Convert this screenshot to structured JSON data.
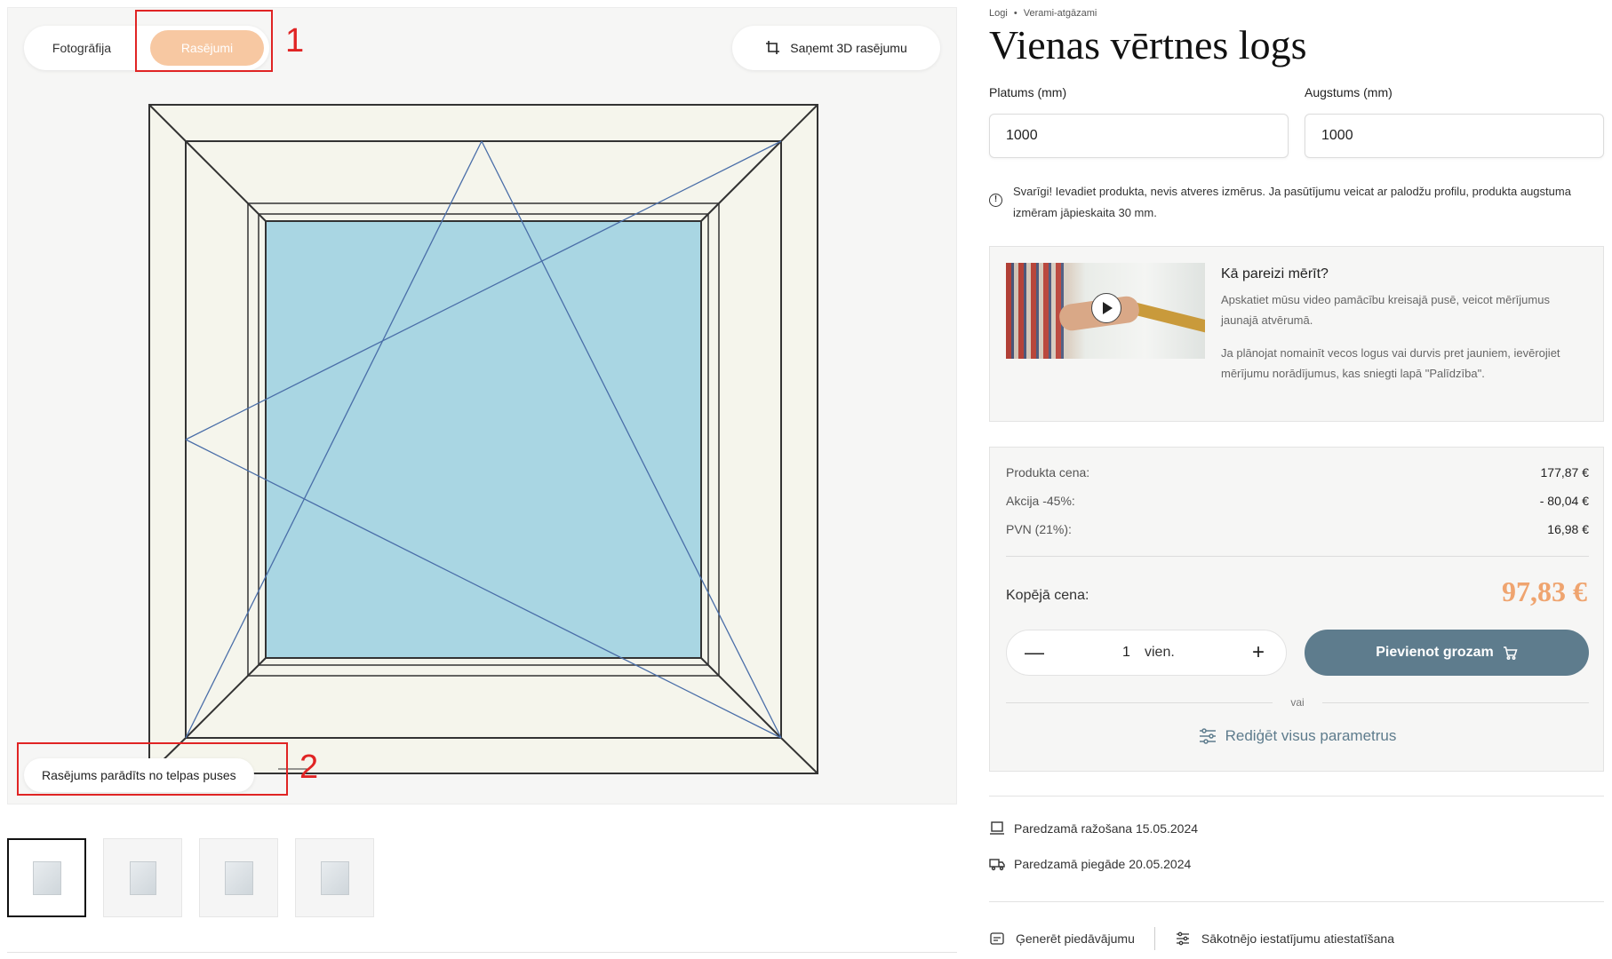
{
  "viewer": {
    "toggle": {
      "photo_label": "Fotogrāfija",
      "drawing_label": "Rasējumi",
      "active": "drawing"
    },
    "btn_3d_label": "Saņemt 3D rasējumu",
    "note_label": "Rasējums parādīts no telpas puses",
    "annotations": [
      "1",
      "2"
    ],
    "colors": {
      "frame": "#f5f5ec",
      "glass": "#a9d6e3",
      "outline": "#333333",
      "opening_lines": "#4a6ea8",
      "annotation": "#e02424",
      "active_toggle": "#f7c8a2"
    },
    "thumbnails": [
      {
        "name": "thumb-1",
        "active": true
      },
      {
        "name": "thumb-2",
        "active": false
      },
      {
        "name": "thumb-3",
        "active": false
      },
      {
        "name": "thumb-4",
        "active": false
      }
    ]
  },
  "product": {
    "breadcrumb": [
      "Logi",
      "•",
      "Verami-atgāzami"
    ],
    "title": "Vienas vērtnes logs",
    "width_label": "Platums (mm)",
    "width_value": "1000",
    "height_label": "Augstums (mm)",
    "height_value": "1000",
    "warning_text": "Svarīgi! Ievadiet produkta, nevis atveres izmērus. Ja pasūtījumu veicat ar palodžu profilu, produkta augstuma izmēram jāpieskaita 30 mm."
  },
  "video_card": {
    "title": "Kā pareizi mērīt?",
    "text1": "Apskatiet mūsu video pamācību kreisajā pusē, veicot mērījumus jaunajā atvērumā.",
    "text2": "Ja plānojat nomainīt vecos logus vai durvis pret jauniem, ievērojiet mērījumu norādījumus, kas sniegti lapā \"Palīdzība\"."
  },
  "pricing": {
    "rows": [
      {
        "label": "Produkta cena:",
        "value": "177,87 €"
      },
      {
        "label": "Akcija -45%:",
        "value": "- 80,04 €"
      },
      {
        "label": "PVN (21%):",
        "value": "16,98 €"
      }
    ],
    "total_label": "Kopējā cena:",
    "total_value": "97,83 €",
    "quantity": "1",
    "unit": "vien.",
    "add_to_cart": "Pievienot grozam",
    "or": "vai",
    "edit_all": "Rediģēt visus parametrus",
    "accent_color": "#5e7c8d",
    "total_color": "#efa46f"
  },
  "delivery": {
    "production": "Paredzamā ražošana 15.05.2024",
    "delivery": "Paredzamā piegāde 20.05.2024"
  },
  "footer_links": {
    "generate_offer": "Ģenerēt piedāvājumu",
    "reset_settings": "Sākotnējo iestatījumu atiestatīšana"
  }
}
